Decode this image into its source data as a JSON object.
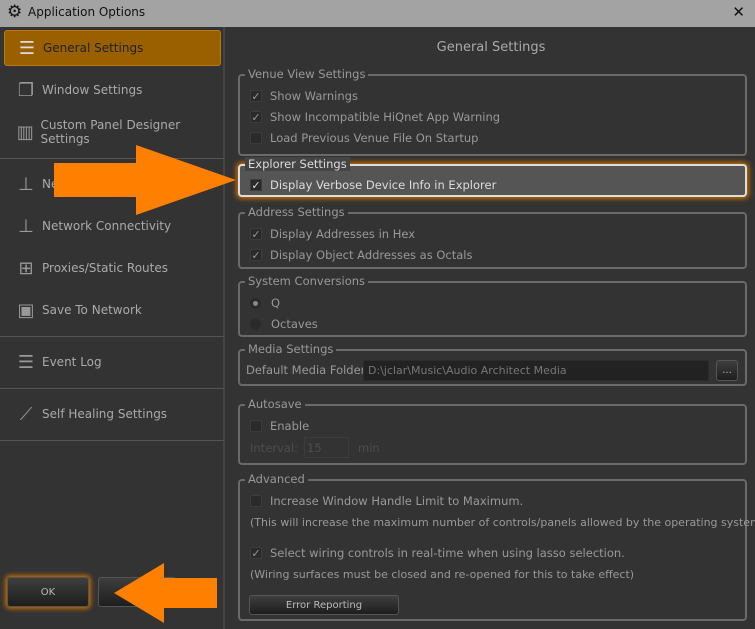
{
  "window": {
    "title": "Application Options",
    "close_label": "✕"
  },
  "sidebar": {
    "items": [
      {
        "label": "General Settings",
        "icon": "general-settings-icon"
      },
      {
        "label": "Window Settings",
        "icon": "windows-icon"
      },
      {
        "label": "Custom Panel Designer Settings",
        "icon": "panel-designer-icon"
      },
      {
        "label": "Ne",
        "icon": "network-icon"
      },
      {
        "label": "Network Connectivity",
        "icon": "network-connectivity-icon"
      },
      {
        "label": "Proxies/Static Routes",
        "icon": "proxies-icon"
      },
      {
        "label": "Save To Network",
        "icon": "save-network-icon"
      },
      {
        "label": "Event Log",
        "icon": "list-icon"
      },
      {
        "label": "Self Healing Settings",
        "icon": "bandage-icon"
      }
    ]
  },
  "footer": {
    "ok_label": "OK"
  },
  "main": {
    "title": "General Settings",
    "venue": {
      "legend": "Venue View Settings",
      "items": [
        {
          "label": "Show Warnings",
          "checked": true
        },
        {
          "label": "Show Incompatible HiQnet App Warning",
          "checked": true
        },
        {
          "label": "Load Previous Venue File On Startup",
          "checked": false
        }
      ]
    },
    "explorer": {
      "legend": "Explorer Settings",
      "items": [
        {
          "label": "Display Verbose Device Info in Explorer",
          "checked": true
        }
      ]
    },
    "address": {
      "legend": "Address Settings",
      "items": [
        {
          "label": "Display Addresses in Hex",
          "checked": true
        },
        {
          "label": "Display Object Addresses as Octals",
          "checked": true
        }
      ]
    },
    "conversions": {
      "legend": "System Conversions",
      "options": [
        {
          "label": "Q",
          "selected": true
        },
        {
          "label": "Octaves",
          "selected": false
        }
      ]
    },
    "media": {
      "legend": "Media Settings",
      "folder_label": "Default Media Folder",
      "folder_value": "D:\\jclar\\Music\\Audio Architect Media",
      "browse_label": "..."
    },
    "autosave": {
      "legend": "Autosave",
      "enable_label": "Enable",
      "enabled": false,
      "interval_label": "Interval:",
      "interval_value": "15",
      "unit": "min"
    },
    "advanced": {
      "legend": "Advanced",
      "handle_label": "Increase Window Handle Limit to Maximum.",
      "handle_checked": false,
      "handle_note": "(This will increase the maximum number of controls/panels allowed by the operating system.)",
      "lasso_label": "Select wiring controls in real-time when using lasso selection.",
      "lasso_checked": true,
      "lasso_note": "(Wiring surfaces must be closed and re-opened for this to take effect)",
      "error_button": "Error Reporting"
    }
  },
  "colors": {
    "accent": "#9a6000",
    "arrow": "#ff8000"
  }
}
